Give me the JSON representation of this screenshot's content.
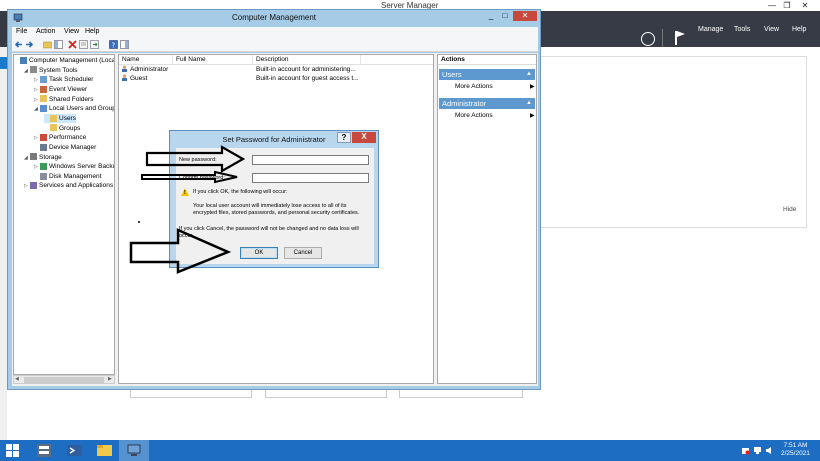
{
  "server_manager": {
    "title": "Server Manager",
    "menu": [
      "Manage",
      "Tools",
      "View",
      "Help"
    ],
    "hide_label": "Hide"
  },
  "window": {
    "title": "Computer Management",
    "menu": [
      "File",
      "Action",
      "View",
      "Help"
    ]
  },
  "tree": [
    {
      "label": "Computer Management (Local",
      "level": 0,
      "expander": "",
      "icon": "computer-icon"
    },
    {
      "label": "System Tools",
      "level": 1,
      "expander": "◢",
      "icon": "tools-icon"
    },
    {
      "label": "Task Scheduler",
      "level": 2,
      "expander": "▷",
      "icon": "clock-icon"
    },
    {
      "label": "Event Viewer",
      "level": 2,
      "expander": "▷",
      "icon": "event-icon"
    },
    {
      "label": "Shared Folders",
      "level": 2,
      "expander": "▷",
      "icon": "folder-icon"
    },
    {
      "label": "Local Users and Groups",
      "level": 2,
      "expander": "◢",
      "icon": "users-icon"
    },
    {
      "label": "Users",
      "level": 3,
      "expander": "",
      "icon": "folder-icon",
      "selected": true
    },
    {
      "label": "Groups",
      "level": 3,
      "expander": "",
      "icon": "folder-icon"
    },
    {
      "label": "Performance",
      "level": 2,
      "expander": "▷",
      "icon": "performance-icon"
    },
    {
      "label": "Device Manager",
      "level": 2,
      "expander": "",
      "icon": "device-icon"
    },
    {
      "label": "Storage",
      "level": 1,
      "expander": "◢",
      "icon": "storage-icon"
    },
    {
      "label": "Windows Server Backup",
      "level": 2,
      "expander": "▷",
      "icon": "backup-icon"
    },
    {
      "label": "Disk Management",
      "level": 2,
      "expander": "",
      "icon": "disk-icon"
    },
    {
      "label": "Services and Applications",
      "level": 1,
      "expander": "▷",
      "icon": "services-icon"
    }
  ],
  "list": {
    "columns": [
      "Name",
      "Full Name",
      "Description"
    ],
    "rows": [
      {
        "name": "Administrator",
        "full_name": "",
        "description": "Built-in account for administering..."
      },
      {
        "name": "Guest",
        "full_name": "",
        "description": "Built-in account for guest access t..."
      }
    ]
  },
  "actions": {
    "header": "Actions",
    "sections": [
      {
        "title": "Users",
        "items": [
          "More Actions"
        ]
      },
      {
        "title": "Administrator",
        "items": [
          "More Actions"
        ]
      }
    ]
  },
  "dialog": {
    "title": "Set Password for Administrator",
    "help_label": "?",
    "close_label": "X",
    "new_password_label": "New password:",
    "confirm_password_label": "Confirm password:",
    "new_password_value": "",
    "confirm_password_value": "",
    "warning_line": "If you click OK, the following will occur:",
    "warning_detail": "Your local user account will immediately lose access to all of its encrypted files, stored passwords, and personal security certificates.",
    "cancel_note": "If you click Cancel, the password will not be changed and no data loss will occur.",
    "ok_label": "OK",
    "cancel_label": "Cancel"
  },
  "taskbar": {
    "time": "7:51 AM",
    "date": "2/25/2021"
  },
  "colors": {
    "window_frame": "#a6cbe6",
    "accent": "#1d6ec2",
    "header_dark": "#363b45",
    "section_blue": "#5d98cf"
  }
}
